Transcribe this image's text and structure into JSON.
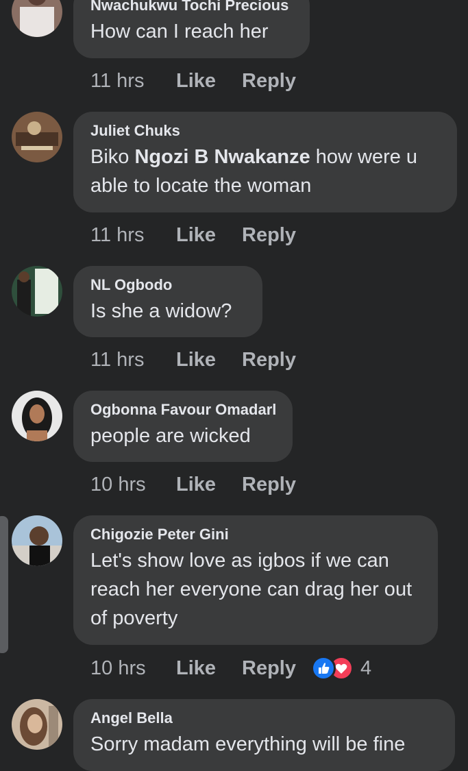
{
  "comments": [
    {
      "author": "Nwachukwu Tochi Precious",
      "text": "How can I reach her",
      "time": "11 hrs",
      "like": "Like",
      "reply": "Reply"
    },
    {
      "author": "Juliet Chuks",
      "text_before": "Biko ",
      "mention": "Ngozi B Nwakanze",
      "text_after": " how were u able to locate the woman",
      "time": "11 hrs",
      "like": "Like",
      "reply": "Reply"
    },
    {
      "author": "NL Ogbodo",
      "text": "Is she a widow?",
      "time": "11 hrs",
      "like": "Like",
      "reply": "Reply"
    },
    {
      "author": "Ogbonna Favour Omadarl",
      "text": "people are wicked",
      "time": "10 hrs",
      "like": "Like",
      "reply": "Reply"
    },
    {
      "author": "Chigozie Peter Gini",
      "text": "Let's show love as igbos if we can reach her everyone can drag her out of poverty",
      "time": "10 hrs",
      "like": "Like",
      "reply": "Reply",
      "reactions": {
        "icons": [
          "like-reaction-icon",
          "love-reaction-icon"
        ],
        "count": "4",
        "like_color": "#1877f2",
        "love_color": "#f33e58"
      }
    },
    {
      "author": "Angel Bella",
      "text": "Sorry madam everything will be fine"
    }
  ],
  "colors": {
    "background": "#242526",
    "bubble": "#3a3b3c",
    "primary_text": "#e4e6eb",
    "secondary_text": "#b0b3b8"
  }
}
